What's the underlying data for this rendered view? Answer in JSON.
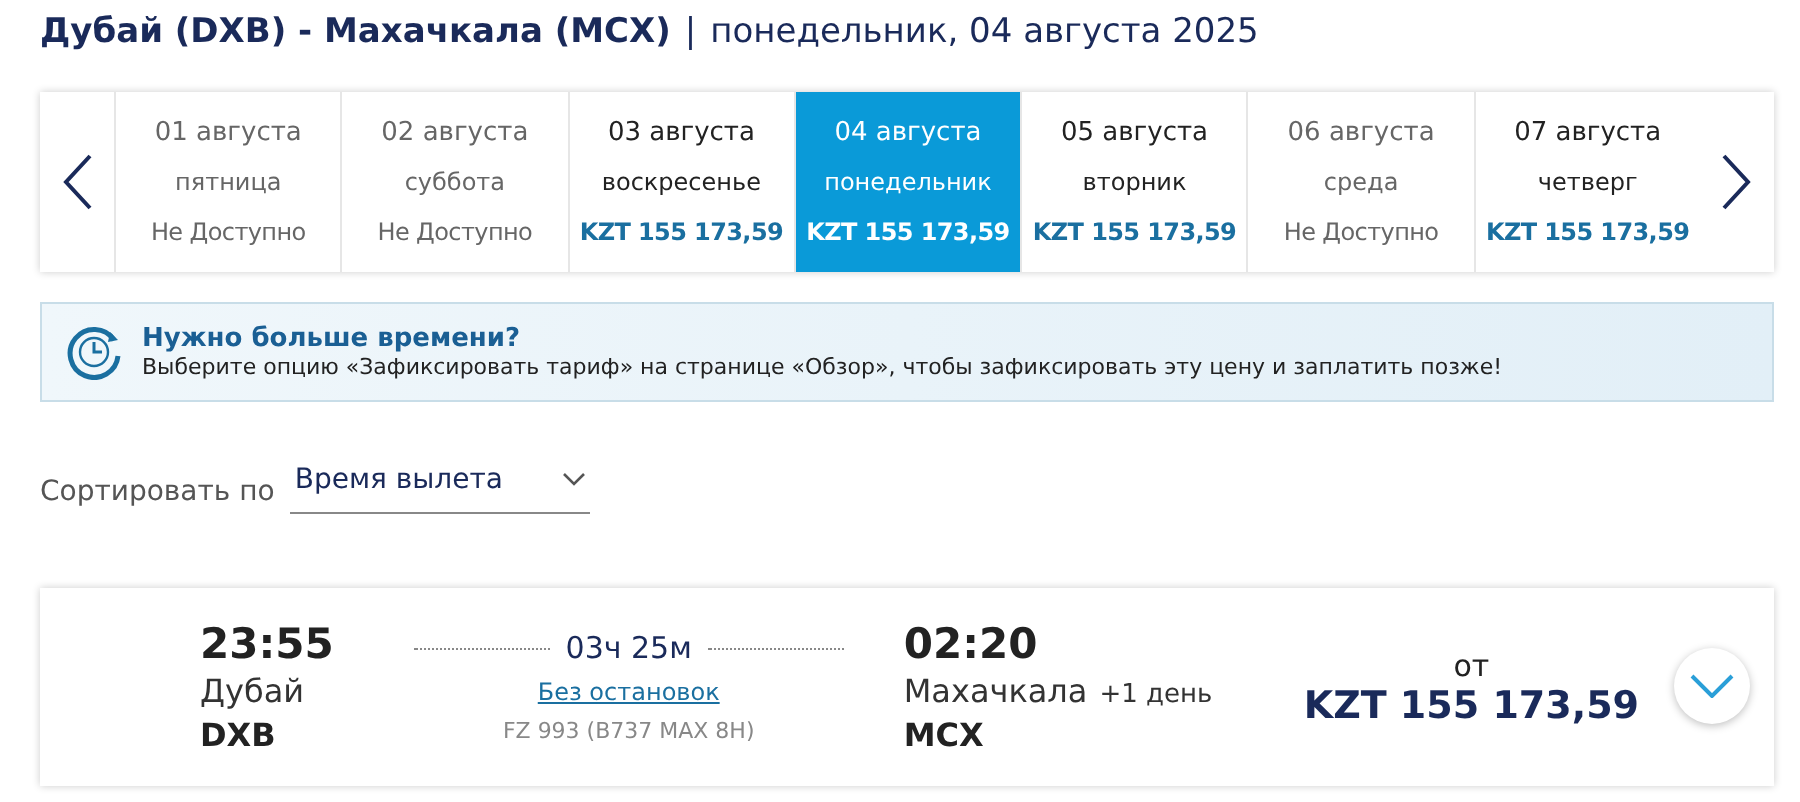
{
  "title": {
    "route": "Дубай (DXB) - Махачкала (MCX)",
    "separator": "|",
    "date": "понедельник, 04 августа 2025"
  },
  "dates": [
    {
      "date": "01 августа",
      "weekday": "пятница",
      "price": "Не Доступно",
      "available": false,
      "selected": false
    },
    {
      "date": "02 августа",
      "weekday": "суббота",
      "price": "Не Доступно",
      "available": false,
      "selected": false
    },
    {
      "date": "03 августа",
      "weekday": "воскресенье",
      "price": "KZT 155 173,59",
      "available": true,
      "selected": false
    },
    {
      "date": "04 августа",
      "weekday": "понедельник",
      "price": "KZT 155 173,59",
      "available": true,
      "selected": true
    },
    {
      "date": "05 августа",
      "weekday": "вторник",
      "price": "KZT 155 173,59",
      "available": true,
      "selected": false
    },
    {
      "date": "06 августа",
      "weekday": "среда",
      "price": "Не Доступно",
      "available": false,
      "selected": false
    },
    {
      "date": "07 августа",
      "weekday": "четверг",
      "price": "KZT 155 173,59",
      "available": true,
      "selected": false
    }
  ],
  "notice": {
    "title": "Нужно больше времени?",
    "text": "Выберите опцию «Зафиксировать тариф» на странице «Обзор», чтобы зафиксировать эту цену и заплатить позже!"
  },
  "sort": {
    "label": "Сортировать по",
    "value": "Время вылета"
  },
  "flight": {
    "depart_time": "23:55",
    "depart_city": "Дубай",
    "depart_code": "DXB",
    "duration": "03ч 25м",
    "stops": "Без остановок",
    "flight_number": "FZ 993 (B737 MAX 8H)",
    "arrive_time": "02:20",
    "arrive_city": "Махачкала",
    "day_offset": "+1 день",
    "arrive_code": "MCX",
    "price_prefix": "от",
    "price": "KZT 155 173,59"
  }
}
